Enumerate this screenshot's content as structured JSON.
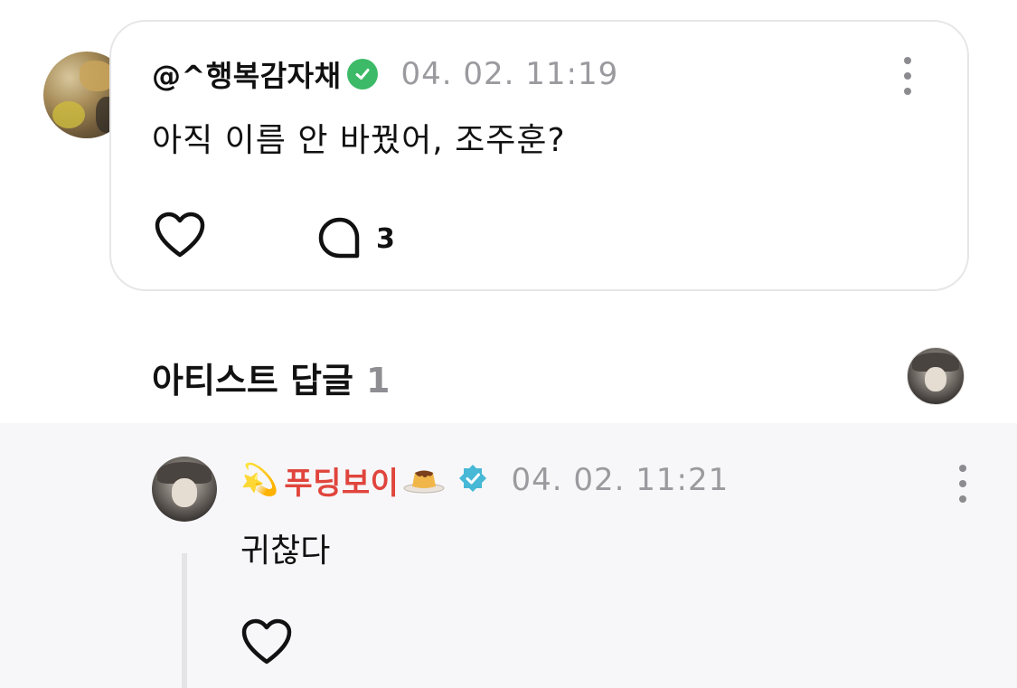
{
  "post": {
    "author": "@^행복감자채",
    "timestamp": "04. 02. 11:19",
    "text": "아직 이름 안 바꿨어, 조주훈?",
    "comment_count": "3",
    "badge_color": "#3dba67"
  },
  "artist_replies": {
    "title": "아티스트 답글",
    "count": "1"
  },
  "reply": {
    "prefix_emoji": "💫",
    "author": "푸딩보이",
    "timestamp": "04. 02. 11:21",
    "text": "귀찮다",
    "name_color": "#e0453d",
    "badge_color": "#47b8d6"
  }
}
